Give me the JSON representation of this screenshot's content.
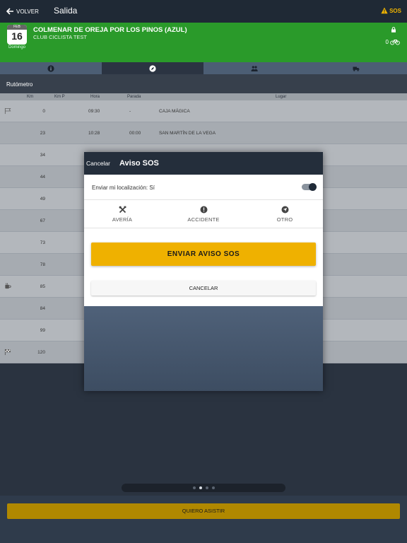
{
  "navbar": {
    "back_label": "VOLVER",
    "title": "Salida",
    "sos_label": "SOS"
  },
  "event": {
    "title": "COLMENAR DE OREJA POR LOS PINOS (AZUL)",
    "club": "CLUB CICLISTA TEST",
    "calendar": {
      "month": "FEB",
      "day": "16",
      "weekday": "Domingo"
    },
    "participants": "0"
  },
  "tabs": [
    {
      "icon": "info-icon"
    },
    {
      "icon": "compass-icon",
      "active": true
    },
    {
      "icon": "people-icon"
    },
    {
      "icon": "truck-icon"
    }
  ],
  "route": {
    "heading": "Rutómetro",
    "columns": {
      "km": "Km",
      "kmp": "Km P",
      "hora": "Hora",
      "parada": "Parada",
      "lugar": "Lugar"
    },
    "rows": [
      {
        "km": "0",
        "kmp": "",
        "hora": "09:30",
        "parada": "-",
        "lugar": "CAJA MÁGICA",
        "icon": "start-flag-icon"
      },
      {
        "km": "23",
        "kmp": "",
        "hora": "10:28",
        "parada": "00:00",
        "lugar": "SAN MARTÍN DE LA VEGA",
        "icon": ""
      },
      {
        "km": "34",
        "kmp": "",
        "hora": "",
        "parada": "",
        "lugar": "",
        "icon": ""
      },
      {
        "km": "44",
        "kmp": "",
        "hora": "",
        "parada": "",
        "lugar": "",
        "icon": ""
      },
      {
        "km": "49",
        "kmp": "",
        "hora": "",
        "parada": "",
        "lugar": "",
        "icon": ""
      },
      {
        "km": "67",
        "kmp": "",
        "hora": "",
        "parada": "",
        "lugar": "",
        "icon": ""
      },
      {
        "km": "73",
        "kmp": "",
        "hora": "",
        "parada": "",
        "lugar": "",
        "icon": ""
      },
      {
        "km": "78",
        "kmp": "",
        "hora": "",
        "parada": "",
        "lugar": "",
        "icon": ""
      },
      {
        "km": "85",
        "kmp": "",
        "hora": "",
        "parada": "",
        "lugar": "",
        "icon": "coffee-icon"
      },
      {
        "km": "84",
        "kmp": "",
        "hora": "",
        "parada": "",
        "lugar": "",
        "icon": ""
      },
      {
        "km": "99",
        "kmp": "",
        "hora": "",
        "parada": "",
        "lugar": "",
        "icon": ""
      },
      {
        "km": "120",
        "kmp": "",
        "hora": "",
        "parada": "",
        "lugar": "",
        "icon": "finish-flag-icon"
      }
    ]
  },
  "pager": {
    "pages": 4,
    "current": 2
  },
  "footer": {
    "attend_label": "QUIERO ASISTIR"
  },
  "sos_modal": {
    "cancel_label": "Cancelar",
    "title": "Aviso SOS",
    "location_label": "Enviar mi localización: Sí",
    "location_enabled": true,
    "types": [
      {
        "label": "AVERÍA",
        "icon": "tools-icon"
      },
      {
        "label": "ACCIDENTE",
        "icon": "alert-icon"
      },
      {
        "label": "OTRO",
        "icon": "navigation-icon"
      }
    ],
    "send_label": "ENVIAR AVISO SOS",
    "cancel_button_label": "CANCELAR"
  },
  "colors": {
    "accent": "#efb100",
    "event_green": "#2a9a2a",
    "navbar": "#1f2935"
  }
}
